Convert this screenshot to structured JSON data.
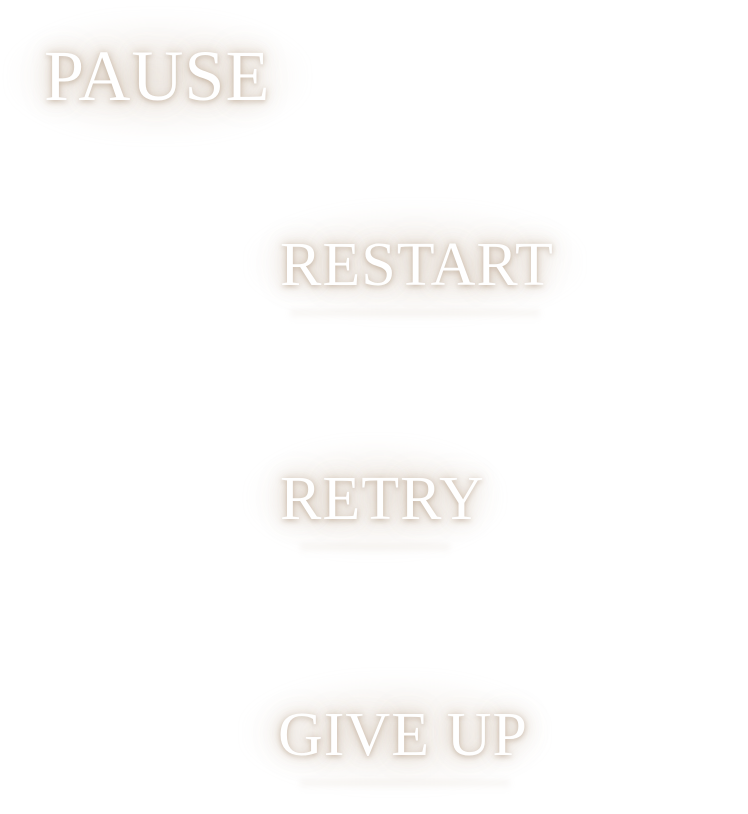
{
  "pause_menu": {
    "title": "PAUSE",
    "items": [
      {
        "label": "RESTART"
      },
      {
        "label": "RETRY"
      },
      {
        "label": "GIVE UP"
      }
    ]
  },
  "colors": {
    "background": "#ffffff",
    "text": "#ffffff",
    "glow": "#aa8c6e"
  }
}
